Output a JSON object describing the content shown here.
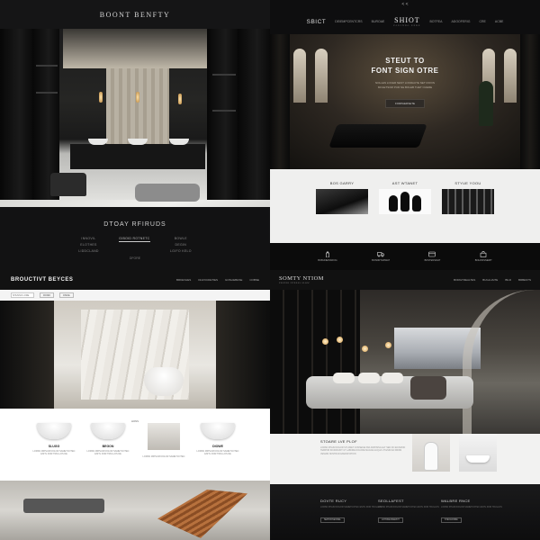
{
  "panel1": {
    "brand": "BOONT BENFTY",
    "footer": {
      "title": "DTOAY RFIRUDS",
      "col1": [
        "INNOVIL",
        "ELOTHES",
        "LIDDCLAND"
      ],
      "col2_highlight": "GIBOID ROTNETC",
      "col3": [
        "BOWLE",
        "DEGIN",
        "LGIFO KELO"
      ],
      "sub": "DFORE"
    }
  },
  "panel2": {
    "controls": "< <",
    "nav_left": "SBICT",
    "nav_links_left": [
      "DEIEMPCENTCRS",
      "BUROAE"
    ],
    "logo": "SHIOT",
    "logo_sub": "PAUINNG EEDE",
    "nav_links_right": [
      "BOTFEA",
      "ADOOFERIG",
      "CRE",
      "ACBE"
    ],
    "hero_title": [
      "STEUT TO",
      "FONT SIGN OTRE"
    ],
    "hero_sub": [
      "NOLLEN LOCER NEST LOKRAUTE NET ROVIN",
      "MOLETSOM PUR NE BOLEB THET OUERE"
    ],
    "cta": "FORPAERSETE",
    "products": [
      {
        "label": "BOS GARRY"
      },
      {
        "label": "AST WTANET"
      },
      {
        "label": "STYUE YOOU"
      }
    ],
    "icons": [
      {
        "icon": "bottle-icon",
        "label": "BOBUNEISSIFOG"
      },
      {
        "icon": "truck-icon",
        "label": "BOSDRTHDWAT"
      },
      {
        "icon": "card-icon",
        "label": "BOSTENSDHT"
      },
      {
        "icon": "bag-icon",
        "label": "BOHONSNERIT"
      }
    ]
  },
  "panel3": {
    "logo": "BROUCTIVT BEYCES",
    "nav": [
      "BRKEVHES",
      "DHVOCDETIES",
      "GOSLIEBHSE",
      "COBNE"
    ],
    "search_placeholder": "SHUNNO LORE",
    "buttons": [
      "RONDI",
      "DSNIE"
    ],
    "tag": "HONS",
    "cards": [
      {
        "title": "SLUGG",
        "desc": "LORSN MIPSUM DOLOR SAMETCOTEC ENITL DOR TRULLOS DE"
      },
      {
        "title": "BEGON",
        "desc": "LORSN MIPSUM DOLOR SAMETCOTEC ENITL DOR TRULLOS DE"
      },
      {
        "title": "",
        "desc": "LORSN MIPSUM DOLOR SAMETCOTEC"
      },
      {
        "title": "DIOWE",
        "desc": "LORSN MIPSUM DOLOR SAMETCOTEC ENITL DOR TRULLOS DE"
      }
    ]
  },
  "panel4": {
    "logo": "SOMTY NTIOM",
    "logo_sub": "PREPER NTRESS SLOW",
    "nav": [
      "BORGTREALTES",
      "BUGLUAITE",
      "BILD",
      "BRBESTS"
    ],
    "info_title": "STOARE LVE PLOF",
    "info_text": "LORSN IPSUM DOLOR SIT AMET CONSEFELTAR ADIPISING ELT SED DO EIUSMOD TEMPOR INCIDIDUNT UT LABORE DOLORE MAGNA ALIQUA UT ENIM AD MINIM VENIAM NOSTRUD EXERCITATION",
    "footer": [
      {
        "title": "DOVTE RUCY",
        "desc": "LORSN IPSUM DOLOR SAMETCOTEC ENITL DOR TRULLOS",
        "button": "SEPIOFINEOMEL"
      },
      {
        "title": "SEOLLAFEST",
        "desc": "LORSN IPSUM DOLOR SAMETCOTEC ENITL DOR TRULLOS",
        "button": "LOHONEONEMOT"
      },
      {
        "title": "WALBRE RNCE",
        "desc": "LORSN IPSUM DOLOR SAMETCOTEC ENITL DOR TRULLOS",
        "button": "STEOLDRIRE"
      }
    ]
  }
}
